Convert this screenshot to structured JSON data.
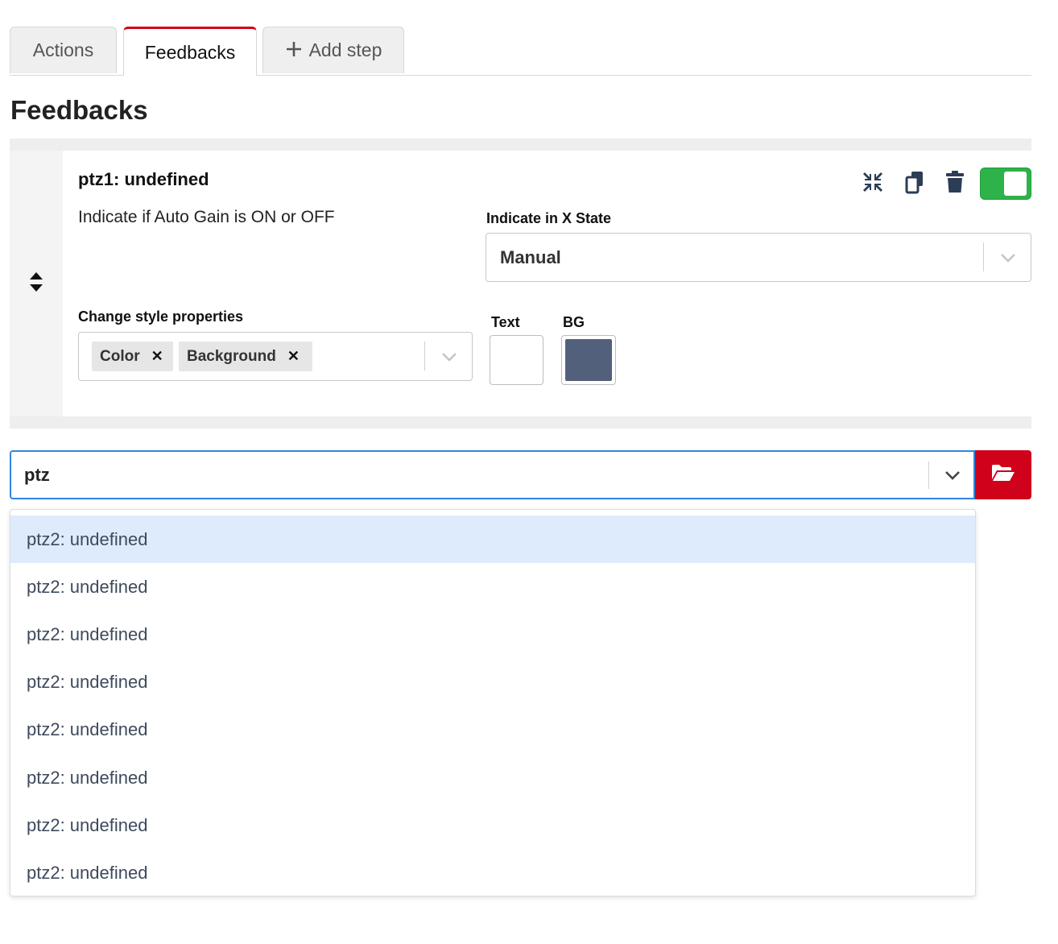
{
  "tabs": [
    {
      "label": "Actions",
      "active": false
    },
    {
      "label": "Feedbacks",
      "active": true
    },
    {
      "label": "Add step",
      "active": false,
      "icon": "plus-icon"
    }
  ],
  "section_title": "Feedbacks",
  "feedback": {
    "name": "ptz1: undefined",
    "description": "Indicate if Auto Gain is ON or OFF",
    "enabled": true,
    "toolbar_icons": [
      "collapse-icon",
      "copy-icon",
      "trash-icon"
    ],
    "state_field": {
      "label": "Indicate in X State",
      "value": "Manual"
    },
    "style_properties": {
      "label": "Change style properties",
      "chips": [
        "Color",
        "Background"
      ]
    },
    "text_color": {
      "label": "Text",
      "value": "#ffffff"
    },
    "bg_color": {
      "label": "BG",
      "value": "#53607c"
    }
  },
  "add_feedback": {
    "search_value": "ptz",
    "options": [
      "ptz2: undefined",
      "ptz2: undefined",
      "ptz2: undefined",
      "ptz2: undefined",
      "ptz2: undefined",
      "ptz2: undefined",
      "ptz2: undefined",
      "ptz2: undefined"
    ],
    "focused_index": 0
  },
  "colors": {
    "accent_red": "#d0021b",
    "toggle_green": "#2db34a",
    "focus_blue": "#2f86e0",
    "option_highlight": "#deebfc"
  }
}
